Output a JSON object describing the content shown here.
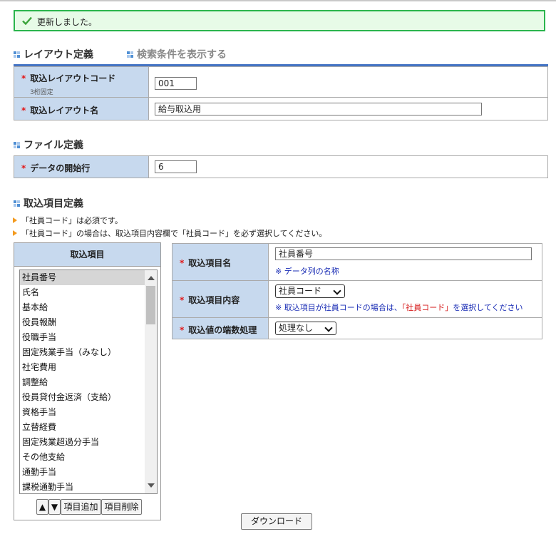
{
  "alert": {
    "message": "更新しました。"
  },
  "layout_section": {
    "title": "レイアウト定義",
    "toggle_link": "検索条件を表示する",
    "fields": [
      {
        "label": "取込レイアウトコード",
        "sub": "3桁固定",
        "value": "001"
      },
      {
        "label": "取込レイアウト名",
        "value": "給与取込用"
      }
    ]
  },
  "file_section": {
    "title": "ファイル定義",
    "fields": [
      {
        "label": "データの開始行",
        "value": "6"
      }
    ]
  },
  "items_section": {
    "title": "取込項目定義",
    "notes": [
      "「社員コード」は必須です。",
      "「社員コード」の場合は、取込項目内容欄で「社員コード」を必ず選択してください。"
    ],
    "list_header": "取込項目",
    "list_items": [
      "社員番号",
      "氏名",
      "基本給",
      "役員報酬",
      "役職手当",
      "固定残業手当（みなし）",
      "社宅費用",
      "調整給",
      "役員貸付金返済（支給）",
      "資格手当",
      "立替経費",
      "固定残業超過分手当",
      "その他支給",
      "通勤手当",
      "課税通勤手当"
    ],
    "selected_index": 0,
    "buttons": {
      "up": "▲",
      "down": "▼",
      "add": "項目追加",
      "remove": "項目削除"
    },
    "detail": {
      "name_label": "取込項目名",
      "name_value": "社員番号",
      "name_hint": "※ データ列の名称",
      "content_label": "取込項目内容",
      "content_value": "社員コード",
      "content_hint_pre": "※ 取込項目が社員コードの場合は、",
      "content_hint_red": "「社員コード」",
      "content_hint_post": "を選択してください",
      "rounding_label": "取込値の端数処理",
      "rounding_value": "処理なし"
    }
  },
  "download_button": "ダウンロード",
  "required_mark": "*"
}
